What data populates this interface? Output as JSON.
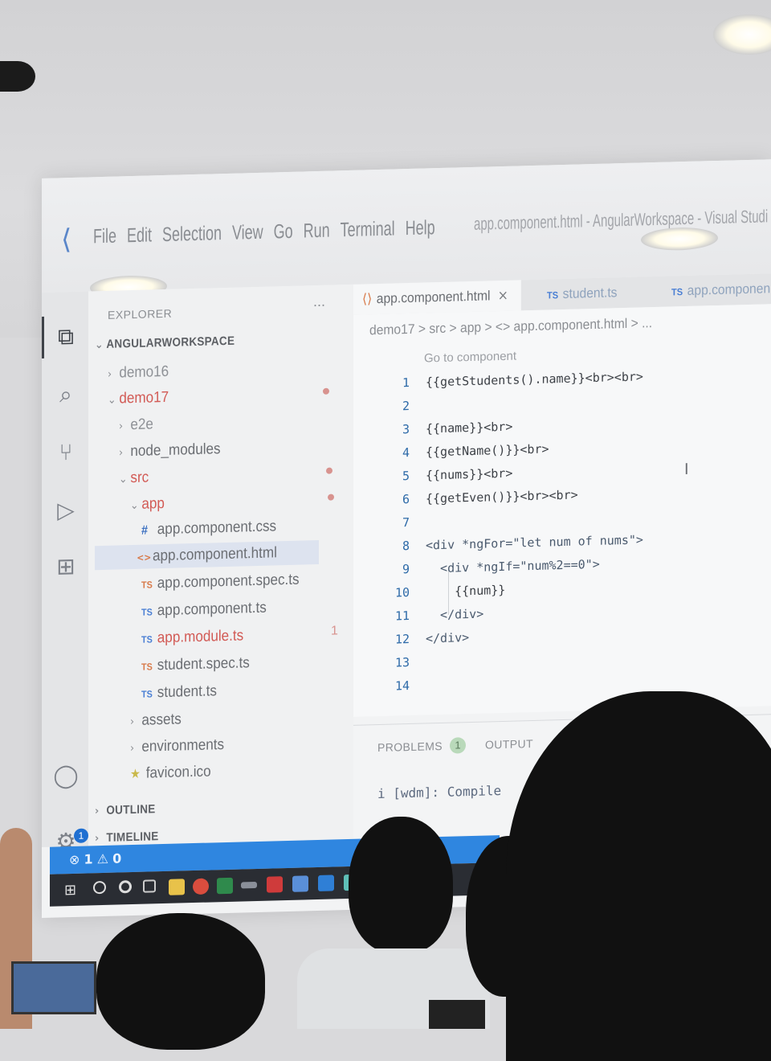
{
  "window": {
    "menu": [
      "File",
      "Edit",
      "Selection",
      "View",
      "Go",
      "Run",
      "Terminal",
      "Help"
    ],
    "title": "app.component.html - AngularWorkspace - Visual Studi"
  },
  "sidebar": {
    "title": "EXPLORER",
    "more": "...",
    "workspace": "ANGULARWORKSPACE",
    "items": [
      {
        "label": "demo16"
      },
      {
        "label": "demo17"
      },
      {
        "label": "e2e"
      },
      {
        "label": "node_modules"
      },
      {
        "label": "src"
      },
      {
        "label": "app"
      },
      {
        "label": "app.component.css",
        "icon": "#"
      },
      {
        "label": "app.component.html",
        "icon": "<>"
      },
      {
        "label": "app.component.spec.ts",
        "icon": "TS"
      },
      {
        "label": "app.component.ts",
        "icon": "TS"
      },
      {
        "label": "app.module.ts",
        "icon": "TS",
        "problems": "1"
      },
      {
        "label": "student.spec.ts",
        "icon": "TS"
      },
      {
        "label": "student.ts",
        "icon": "TS"
      },
      {
        "label": "assets"
      },
      {
        "label": "environments"
      },
      {
        "label": "favicon.ico"
      }
    ],
    "outline": "OUTLINE",
    "timeline": "TIMELINE"
  },
  "tabs": [
    {
      "label": "app.component.html",
      "close": "×"
    },
    {
      "label": "student.ts",
      "icon": "TS"
    },
    {
      "label": "app.componen",
      "icon": "TS"
    }
  ],
  "editor": {
    "breadcrumb": "demo17 > src > app > <> app.component.html > ...",
    "codelens": "Go to component",
    "line_numbers": [
      "1",
      "2",
      "3",
      "4",
      "5",
      "6",
      "7",
      "8",
      "9",
      "10",
      "11",
      "12",
      "13",
      "14"
    ],
    "lines": [
      "{{getStudents().name}}<br><br>",
      "",
      "{{name}}<br>",
      "{{getName()}}<br>",
      "{{nums}}<br>",
      "{{getEven()}}<br><br>",
      "",
      "<div *ngFor=\"let num of nums\">",
      "  <div *ngIf=\"num%2==0\">",
      "    {{num}}",
      "  </div>",
      "</div>",
      "",
      ""
    ]
  },
  "panel": {
    "problems": "PROBLEMS",
    "problems_count": "1",
    "output": "OUTPUT",
    "terminal_line": "i [wdm]: Compile"
  },
  "statusbar": {
    "errors": "1",
    "warnings": "0"
  },
  "colors": {
    "statusbar": "#2f86e0",
    "ts_icon": "#4a7fd4",
    "modified": "#d25a55"
  }
}
